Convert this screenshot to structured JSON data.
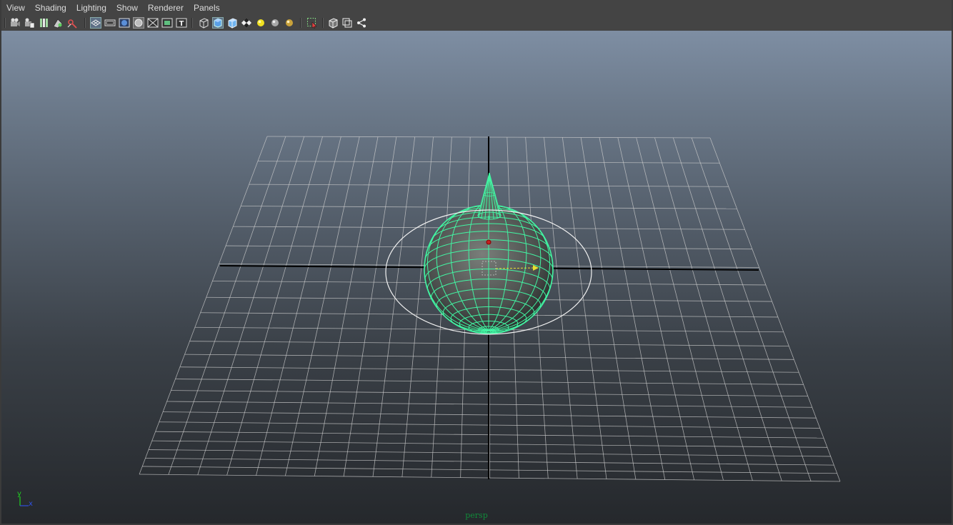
{
  "menu": {
    "items": [
      {
        "id": "view",
        "label": "View"
      },
      {
        "id": "shading",
        "label": "Shading"
      },
      {
        "id": "lighting",
        "label": "Lighting"
      },
      {
        "id": "show",
        "label": "Show"
      },
      {
        "id": "renderer",
        "label": "Renderer"
      },
      {
        "id": "panels",
        "label": "Panels"
      }
    ]
  },
  "toolbar": {
    "groups": [
      [
        "select-camera-icon",
        "camera-attributes-icon",
        "bookmarks-icon",
        "image-plane-icon",
        "2d-pan-zoom-icon"
      ],
      [
        "grid-icon",
        "film-gate-icon",
        "resolution-gate-icon",
        "gate-mask-icon",
        "field-chart-icon",
        "safe-title-icon"
      ],
      [
        "wireframe-icon",
        "smooth-shade-icon",
        "default-material-icon",
        "textured-icon",
        "use-all-lights-icon",
        "shadows-icon",
        "ambient-occlusion-icon"
      ],
      [
        "isolate-select-icon"
      ],
      [
        "xray-icon",
        "xray-joints-icon",
        "xray-components-icon"
      ]
    ]
  },
  "viewport": {
    "camera_label": "persp",
    "axis_labels": {
      "y": "y",
      "x": "x"
    },
    "colors": {
      "wireframe": "#42f5a3",
      "grid": "#cfcfcf",
      "axis": "#000000",
      "bounding_circle": "#f2f2f2",
      "camera_label": "#118a3a"
    }
  }
}
